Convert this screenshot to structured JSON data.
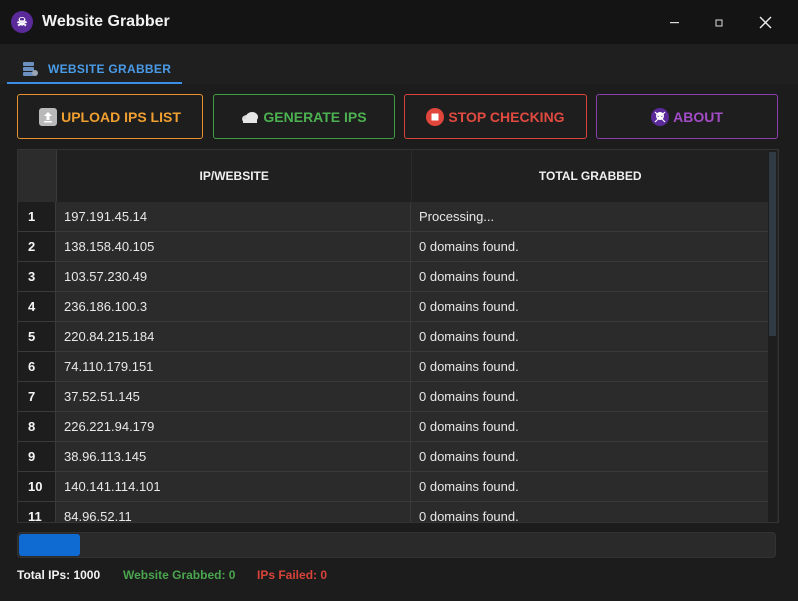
{
  "window": {
    "title": "Website Grabber"
  },
  "tabs": [
    {
      "label": "WEBSITE GRABBER",
      "icon": "server-icon"
    }
  ],
  "buttons": {
    "upload": {
      "label": "UPLOAD IPS LIST",
      "icon": "upload-icon",
      "color": "#f0a030"
    },
    "generate": {
      "label": "GENERATE IPS",
      "icon": "cloud-icon",
      "color": "#4cb150"
    },
    "stop": {
      "label": "STOP CHECKING",
      "icon": "stop-icon",
      "color": "#e04a40"
    },
    "about": {
      "label": "ABOUT",
      "icon": "skull-icon",
      "color": "#a34cc8"
    }
  },
  "table": {
    "columns": [
      "IP/WEBSITE",
      "TOTAL GRABBED"
    ],
    "rows": [
      {
        "n": "1",
        "ip": "197.191.45.14",
        "total": "Processing..."
      },
      {
        "n": "2",
        "ip": "138.158.40.105",
        "total": "0 domains found."
      },
      {
        "n": "3",
        "ip": "103.57.230.49",
        "total": "0 domains found."
      },
      {
        "n": "4",
        "ip": "236.186.100.3",
        "total": "0 domains found."
      },
      {
        "n": "5",
        "ip": "220.84.215.184",
        "total": "0 domains found."
      },
      {
        "n": "6",
        "ip": "74.110.179.151",
        "total": "0 domains found."
      },
      {
        "n": "7",
        "ip": "37.52.51.145",
        "total": "0 domains found."
      },
      {
        "n": "8",
        "ip": "226.221.94.179",
        "total": "0 domains found."
      },
      {
        "n": "9",
        "ip": "38.96.113.145",
        "total": "0 domains found."
      },
      {
        "n": "10",
        "ip": "140.141.114.101",
        "total": "0 domains found."
      },
      {
        "n": "11",
        "ip": "84.96.52.11",
        "total": "0 domains found."
      }
    ]
  },
  "progress": {
    "fraction": 0.08
  },
  "status": {
    "total": "Total IPs: 1000",
    "grabbed": "Website Grabbed: 0",
    "failed": "IPs Failed: 0"
  }
}
